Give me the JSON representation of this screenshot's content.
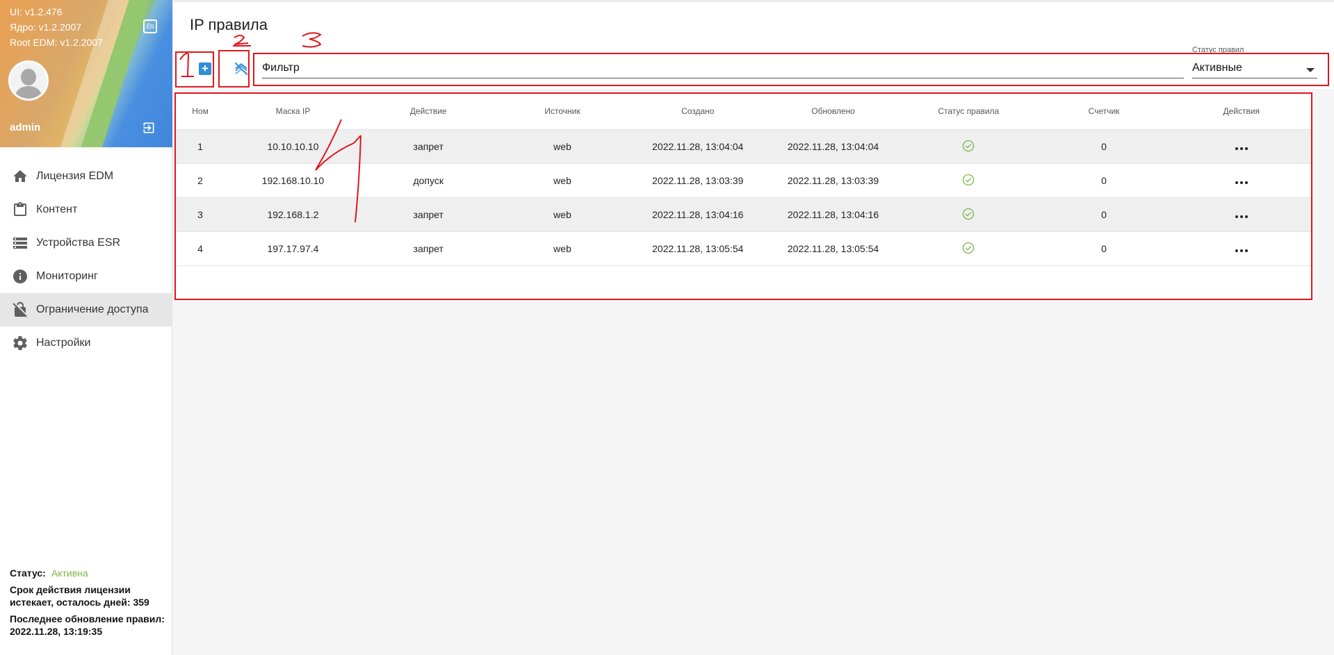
{
  "sidebar": {
    "versions": [
      "UI: v1.2.476",
      "Ядро: v1.2.2007",
      "Root EDM: v1.2.2007"
    ],
    "username": "admin",
    "nav": [
      {
        "label": "Лицензия EDM",
        "icon": "home-icon",
        "active": false
      },
      {
        "label": "Контент",
        "icon": "clipboard-icon",
        "active": false
      },
      {
        "label": "Устройства ESR",
        "icon": "server-icon",
        "active": false
      },
      {
        "label": "Мониторинг",
        "icon": "info-icon",
        "active": false
      },
      {
        "label": "Ограничение доступа",
        "icon": "lock-off-icon",
        "active": true
      },
      {
        "label": "Настройки",
        "icon": "gear-icon",
        "active": false
      }
    ],
    "footer": {
      "status_label": "Статус:",
      "status_value": "Активна",
      "license_text": "Срок действия лицензии истекает, осталось дней: 359",
      "update_text": "Последнее обновление правил: 2022.11.28, 13:19:35"
    }
  },
  "main": {
    "title": "IP правила",
    "filter_placeholder": "Фильтр",
    "status_select": {
      "label": "Статус правил",
      "value": "Активные"
    },
    "columns": [
      "Ном",
      "Маска IP",
      "Действие",
      "Источник",
      "Создано",
      "Обновлено",
      "Статус правила",
      "Счетчик",
      "Действия"
    ],
    "rows": [
      {
        "num": "1",
        "mask": "10.10.10.10",
        "action": "запрет",
        "source": "web",
        "created": "2022.11.28, 13:04:04",
        "updated": "2022.11.28, 13:04:04",
        "counter": "0"
      },
      {
        "num": "2",
        "mask": "192.168.10.10",
        "action": "допуск",
        "source": "web",
        "created": "2022.11.28, 13:03:39",
        "updated": "2022.11.28, 13:03:39",
        "counter": "0"
      },
      {
        "num": "3",
        "mask": "192.168.1.2",
        "action": "запрет",
        "source": "web",
        "created": "2022.11.28, 13:04:16",
        "updated": "2022.11.28, 13:04:16",
        "counter": "0"
      },
      {
        "num": "4",
        "mask": "197.17.97.4",
        "action": "запрет",
        "source": "web",
        "created": "2022.11.28, 13:05:54",
        "updated": "2022.11.28, 13:05:54",
        "counter": "0"
      }
    ]
  },
  "colors": {
    "accent": "#2f8fd8",
    "active_status": "#7ab648",
    "annotation": "#e0161c"
  }
}
